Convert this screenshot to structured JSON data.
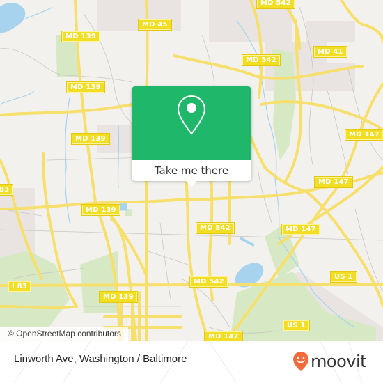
{
  "map": {
    "attribution": "© OpenStreetMap contributors",
    "colors": {
      "background": "#f2f1ee",
      "road_major": "#f7df6b",
      "road_minor": "#bdbdbd",
      "water": "#a7d3ef",
      "park": "#d6e9c4",
      "residential": "#e9e4e1",
      "shield_fill": "#f3de26"
    },
    "road_labels": [
      {
        "id": "md542-top",
        "text": "MD 542"
      },
      {
        "id": "md45",
        "text": "MD 45"
      },
      {
        "id": "md41",
        "text": "MD 41"
      },
      {
        "id": "md139-a",
        "text": "MD 139"
      },
      {
        "id": "md542-b",
        "text": "MD 542"
      },
      {
        "id": "md139-b",
        "text": "MD 139"
      },
      {
        "id": "md147-a",
        "text": "MD 147"
      },
      {
        "id": "md139-c",
        "text": "MD 139"
      },
      {
        "id": "md147-b",
        "text": "MD 147"
      },
      {
        "id": "i83-top",
        "text": "83"
      },
      {
        "id": "md139-d",
        "text": "MD 139"
      },
      {
        "id": "md542-c",
        "text": "MD 542"
      },
      {
        "id": "md147-c",
        "text": "MD 147"
      },
      {
        "id": "i83",
        "text": "I 83"
      },
      {
        "id": "md542-d",
        "text": "MD 542"
      },
      {
        "id": "us1-a",
        "text": "US 1"
      },
      {
        "id": "md139-e",
        "text": "MD 139"
      },
      {
        "id": "us1-b",
        "text": "US 1"
      },
      {
        "id": "md147-d",
        "text": "MD 147"
      }
    ]
  },
  "popup": {
    "icon": "map-pin-icon",
    "accent": "#1fb86a",
    "cta_label": "Take me there"
  },
  "footer": {
    "place": "Linworth Ave, Washington / Baltimore",
    "logo_text": "moovit",
    "logo_color": "#f26b3a"
  }
}
